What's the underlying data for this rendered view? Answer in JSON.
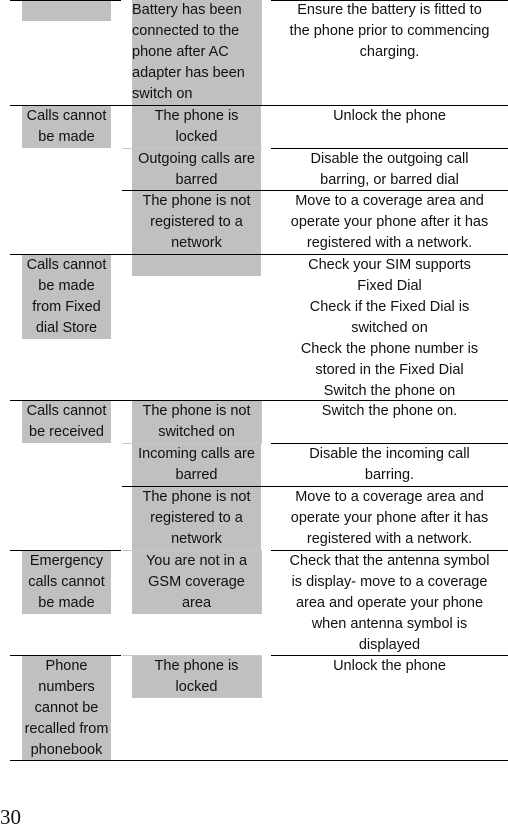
{
  "colors": {
    "highlight": "#c0c0c0",
    "rule": "#000000"
  },
  "rows": [
    {
      "problem": "",
      "causes": [
        {
          "cause": "Battery has been\nconnected to the\nphone after AC\nadapter has been\nswitch on",
          "solution": "Ensure the battery is fitted to\nthe phone prior to commencing\ncharging."
        }
      ]
    },
    {
      "problem": "Calls cannot\nbe made",
      "causes": [
        {
          "cause": "The phone is\nlocked",
          "solution": "Unlock the phone"
        },
        {
          "cause": "Outgoing calls are\nbarred",
          "solution": "Disable the outgoing call\nbarring, or barred dial"
        },
        {
          "cause": "The phone is not\nregistered to a\nnetwork",
          "solution": "Move to a coverage area and\noperate your phone after it has\nregistered with a network."
        }
      ]
    },
    {
      "problem": "Calls cannot\nbe made\nfrom Fixed\ndial Store",
      "causes": [
        {
          "cause": "",
          "solution": "Check your SIM supports\nFixed Dial\nCheck if the Fixed Dial is\nswitched on\nCheck the phone number is\nstored in the Fixed Dial\nSwitch the phone on"
        }
      ]
    },
    {
      "problem": "Calls cannot\nbe received",
      "causes": [
        {
          "cause": "The phone is not\nswitched on",
          "solution": "Switch the phone on."
        },
        {
          "cause": "Incoming calls are\nbarred",
          "solution": "Disable the incoming call\nbarring."
        },
        {
          "cause": "The phone is not\nregistered to a\nnetwork",
          "solution": "Move to a coverage area and\noperate your phone after it has\nregistered with a network."
        }
      ]
    },
    {
      "problem": "Emergency\ncalls cannot\nbe made",
      "causes": [
        {
          "cause": "You are not in a\nGSM coverage\narea",
          "solution": "Check that the antenna symbol\nis display- move to a coverage\narea and operate your phone\nwhen antenna symbol is\ndisplayed"
        }
      ]
    },
    {
      "problem": "Phone\nnumbers\ncannot be\nrecalled from\nphonebook",
      "causes": [
        {
          "cause": "The phone is\nlocked",
          "solution": "Unlock the phone"
        }
      ]
    }
  ],
  "page_number": "30"
}
